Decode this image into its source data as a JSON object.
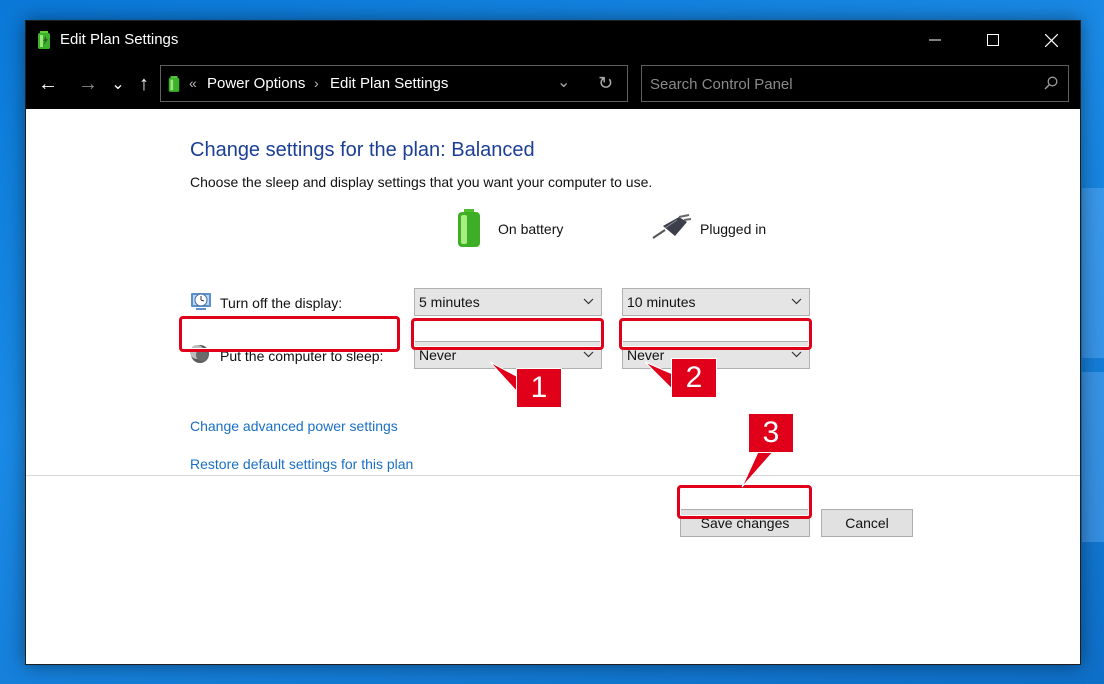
{
  "window": {
    "title": "Edit Plan Settings",
    "controls": {
      "minimize": "—",
      "maximize": "☐",
      "close": "✕"
    }
  },
  "toolbar": {
    "back_icon": "←",
    "forward_icon": "→",
    "recent_icon": "⌄",
    "up_icon": "↑",
    "breadcrumb": {
      "overflow": "«",
      "items": [
        "Power Options",
        "Edit Plan Settings"
      ],
      "separator": "›"
    },
    "dropdown_icon": "⌄",
    "refresh_icon": "↻",
    "search": {
      "placeholder": "Search Control Panel",
      "value": ""
    }
  },
  "main": {
    "heading": "Change settings for the plan: Balanced",
    "subtext": "Choose the sleep and display settings that you want your computer to use.",
    "columns": {
      "battery": "On battery",
      "plugged": "Plugged in"
    },
    "rows": [
      {
        "label": "Turn off the display:",
        "battery_value": "5 minutes",
        "plugged_value": "10 minutes"
      },
      {
        "label": "Put the computer to sleep:",
        "battery_value": "Never",
        "plugged_value": "Never"
      }
    ],
    "links": {
      "advanced": "Change advanced power settings",
      "restore": "Restore default settings for this plan"
    },
    "buttons": {
      "save": "Save changes",
      "cancel": "Cancel"
    }
  },
  "annotations": {
    "step1": "1",
    "step2": "2",
    "step3": "3"
  },
  "colors": {
    "accent": "#e0001a",
    "heading": "#1b3f94",
    "link": "#1a6fc4",
    "desktop": "#0a78d7"
  }
}
